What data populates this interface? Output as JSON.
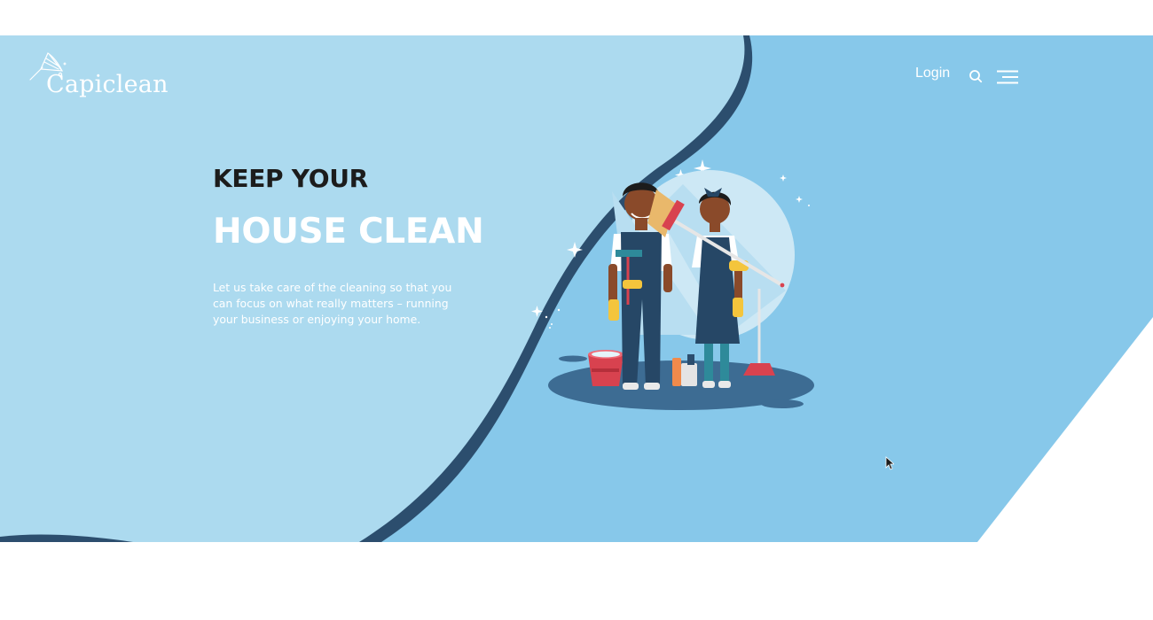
{
  "brand": {
    "name": "Capiclean"
  },
  "nav": {
    "login_label": "Login"
  },
  "hero": {
    "title_small": "KEEP YOUR",
    "title_big": "HOUSE CLEAN",
    "subtitle": "Let us take care of the cleaning so that you can focus on what really matters – running your business or enjoying your home."
  },
  "icons": {
    "search": "search-icon",
    "menu": "hamburger-menu-icon",
    "logo": "duster-icon"
  },
  "colors": {
    "hero_light": "#acdaef",
    "hero_mid": "#87c8ea",
    "shadow": "#2c4e6e",
    "heading_dark": "#1c1c1c",
    "accent_red": "#d8424f",
    "uniform_navy": "#264766"
  }
}
